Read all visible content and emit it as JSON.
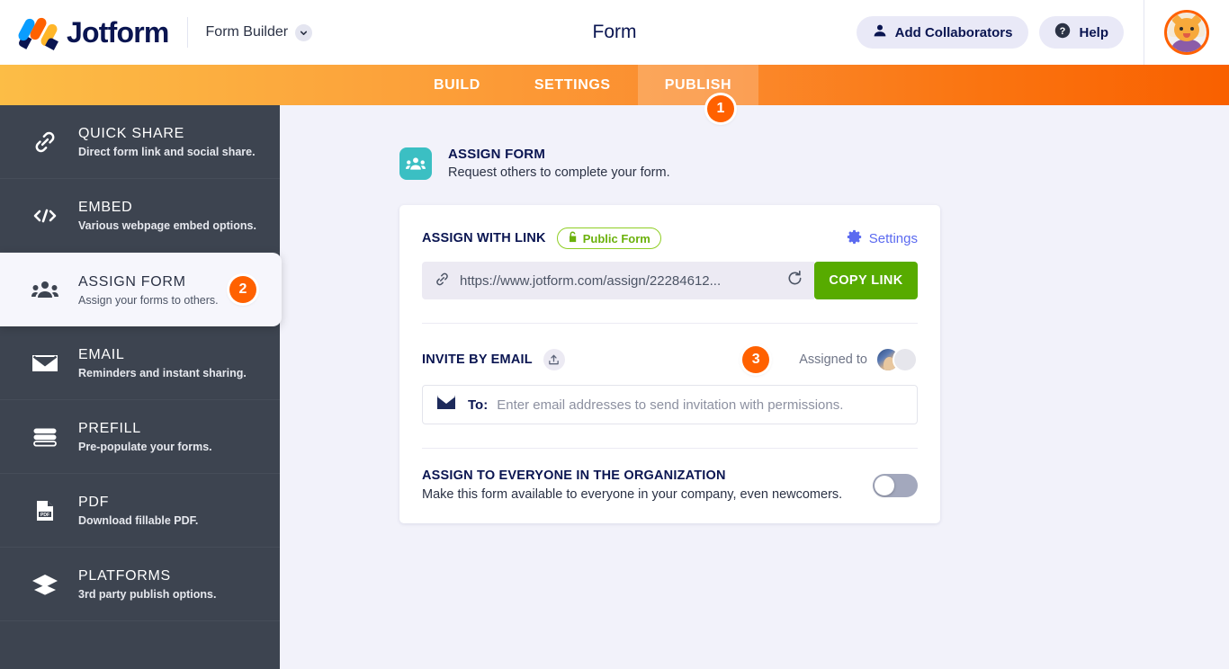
{
  "header": {
    "logo_text": "Jotform",
    "product_menu": "Form Builder",
    "title": "Form",
    "add_collaborators": "Add Collaborators",
    "help": "Help",
    "icons": {
      "person": "person-icon",
      "question": "question-mark-icon",
      "chevron": "chevron-down-icon",
      "avatar": "user-avatar"
    }
  },
  "nav": {
    "tabs": [
      {
        "label": "BUILD",
        "active": false
      },
      {
        "label": "SETTINGS",
        "active": false
      },
      {
        "label": "PUBLISH",
        "active": true
      }
    ],
    "step_badge": "1"
  },
  "sidebar": {
    "items": [
      {
        "title": "QUICK SHARE",
        "desc": "Direct form link and social share.",
        "icon": "link-icon",
        "active": false,
        "badge": null
      },
      {
        "title": "EMBED",
        "desc": "Various webpage embed options.",
        "icon": "code-icon",
        "active": false,
        "badge": null
      },
      {
        "title": "ASSIGN FORM",
        "desc": "Assign your forms to others.",
        "icon": "people-group-icon",
        "active": true,
        "badge": "2"
      },
      {
        "title": "EMAIL",
        "desc": "Reminders and instant sharing.",
        "icon": "envelope-icon",
        "active": false,
        "badge": null
      },
      {
        "title": "PREFILL",
        "desc": "Pre-populate your forms.",
        "icon": "sliders-icon",
        "active": false,
        "badge": null
      },
      {
        "title": "PDF",
        "desc": "Download fillable PDF.",
        "icon": "pdf-file-icon",
        "active": false,
        "badge": null
      },
      {
        "title": "PLATFORMS",
        "desc": "3rd party publish options.",
        "icon": "layers-icon",
        "active": false,
        "badge": null
      }
    ]
  },
  "main": {
    "section": {
      "title": "ASSIGN FORM",
      "desc": "Request others to complete your form.",
      "icon": "people-group-icon",
      "icon_color": "#3bbfc3"
    },
    "assign_with_link": {
      "label": "ASSIGN WITH LINK",
      "visibility_badge": "Public Form",
      "visibility_icon": "unlock-icon",
      "settings_label": "Settings",
      "settings_icon": "gear-icon",
      "link_icon": "chain-link-icon",
      "url": "https://www.jotform.com/assign/22284612...",
      "refresh_icon": "refresh-icon",
      "copy_button": "COPY LINK",
      "copy_button_color": "#57ab00"
    },
    "invite_by_email": {
      "label": "INVITE BY EMAIL",
      "share_icon": "share-upload-icon",
      "step_badge": "3",
      "assigned_label": "Assigned to",
      "to_label": "To:",
      "email_icon": "envelope-icon",
      "email_placeholder": "Enter email addresses to send invitation with permissions."
    },
    "assign_everyone": {
      "title": "ASSIGN TO EVERYONE IN THE ORGANIZATION",
      "desc": "Make this form available to everyone in your company, even newcomers.",
      "toggle_on": false
    }
  },
  "colors": {
    "brand_navy": "#0a1551",
    "accent_orange": "#ff6100",
    "sidebar_bg": "#3d4450",
    "page_bg": "#f2f2fa",
    "teal": "#3bbfc3",
    "green": "#57ab00",
    "badge_green": "#6bb10c",
    "link_blue": "#5b6af0"
  }
}
